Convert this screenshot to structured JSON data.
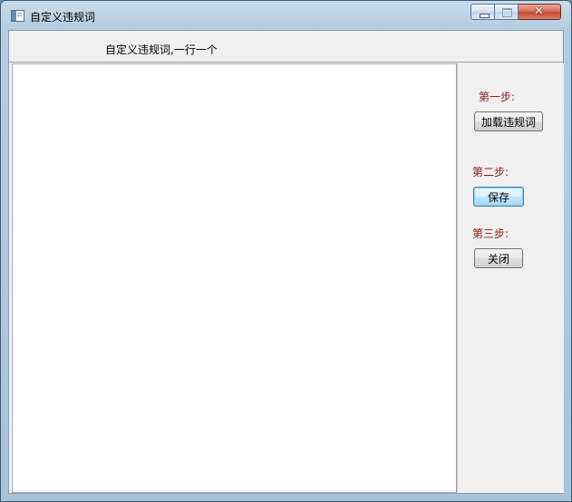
{
  "window": {
    "title": "自定义违规词",
    "controls": {
      "minimize_icon": "minimize-icon",
      "maximize_icon": "maximize-icon",
      "close_label": "✕"
    }
  },
  "header": {
    "instruction": "自定义违规词,一行一个"
  },
  "editor": {
    "value": ""
  },
  "steps": {
    "step1_label": "第一步:",
    "step1_button": "加载违规词",
    "step2_label": "第二步:",
    "step2_button": "保存",
    "step3_label": "第三步:",
    "step3_button": "关闭"
  },
  "colors": {
    "step_label": "#8b1a1a",
    "focus_border": "#3c7fb1"
  }
}
